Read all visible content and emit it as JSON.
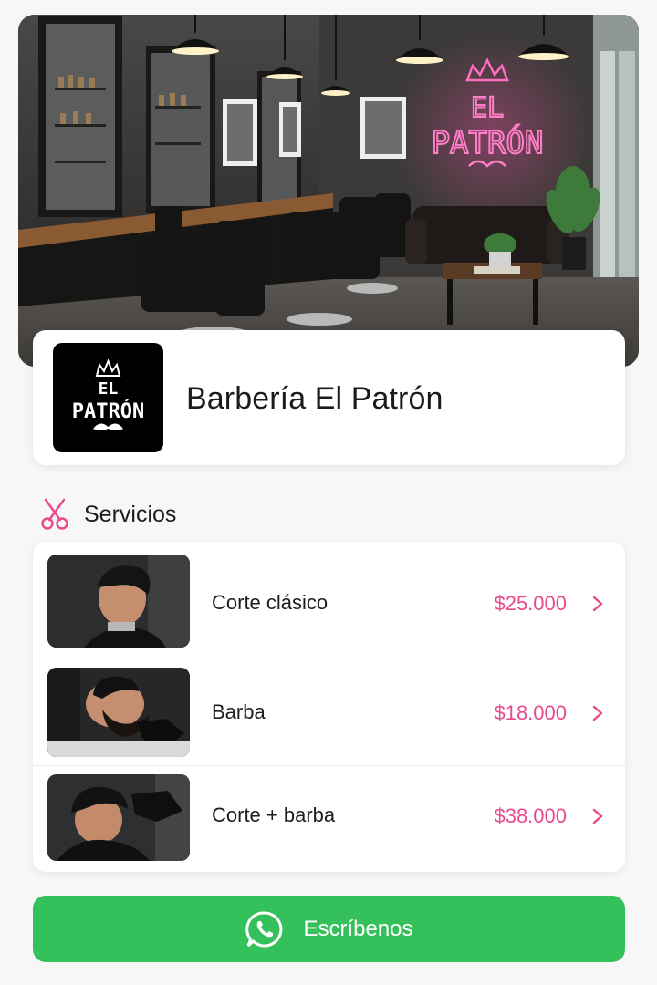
{
  "hero": {
    "neon_line1": "EL",
    "neon_line2": "PATRÓN"
  },
  "profile": {
    "logo_line1": "EL",
    "logo_line2": "PATRÓN",
    "name": "Barbería El Patrón"
  },
  "services": {
    "title": "Servicios",
    "items": [
      {
        "name": "Corte clásico",
        "price": "$25.000"
      },
      {
        "name": "Barba",
        "price": "$18.000"
      },
      {
        "name": "Corte + barba",
        "price": "$38.000"
      }
    ]
  },
  "cta": {
    "label": "Escríbenos"
  },
  "colors": {
    "accent_pink": "#e84a8c",
    "whatsapp_green": "#34c05a"
  }
}
